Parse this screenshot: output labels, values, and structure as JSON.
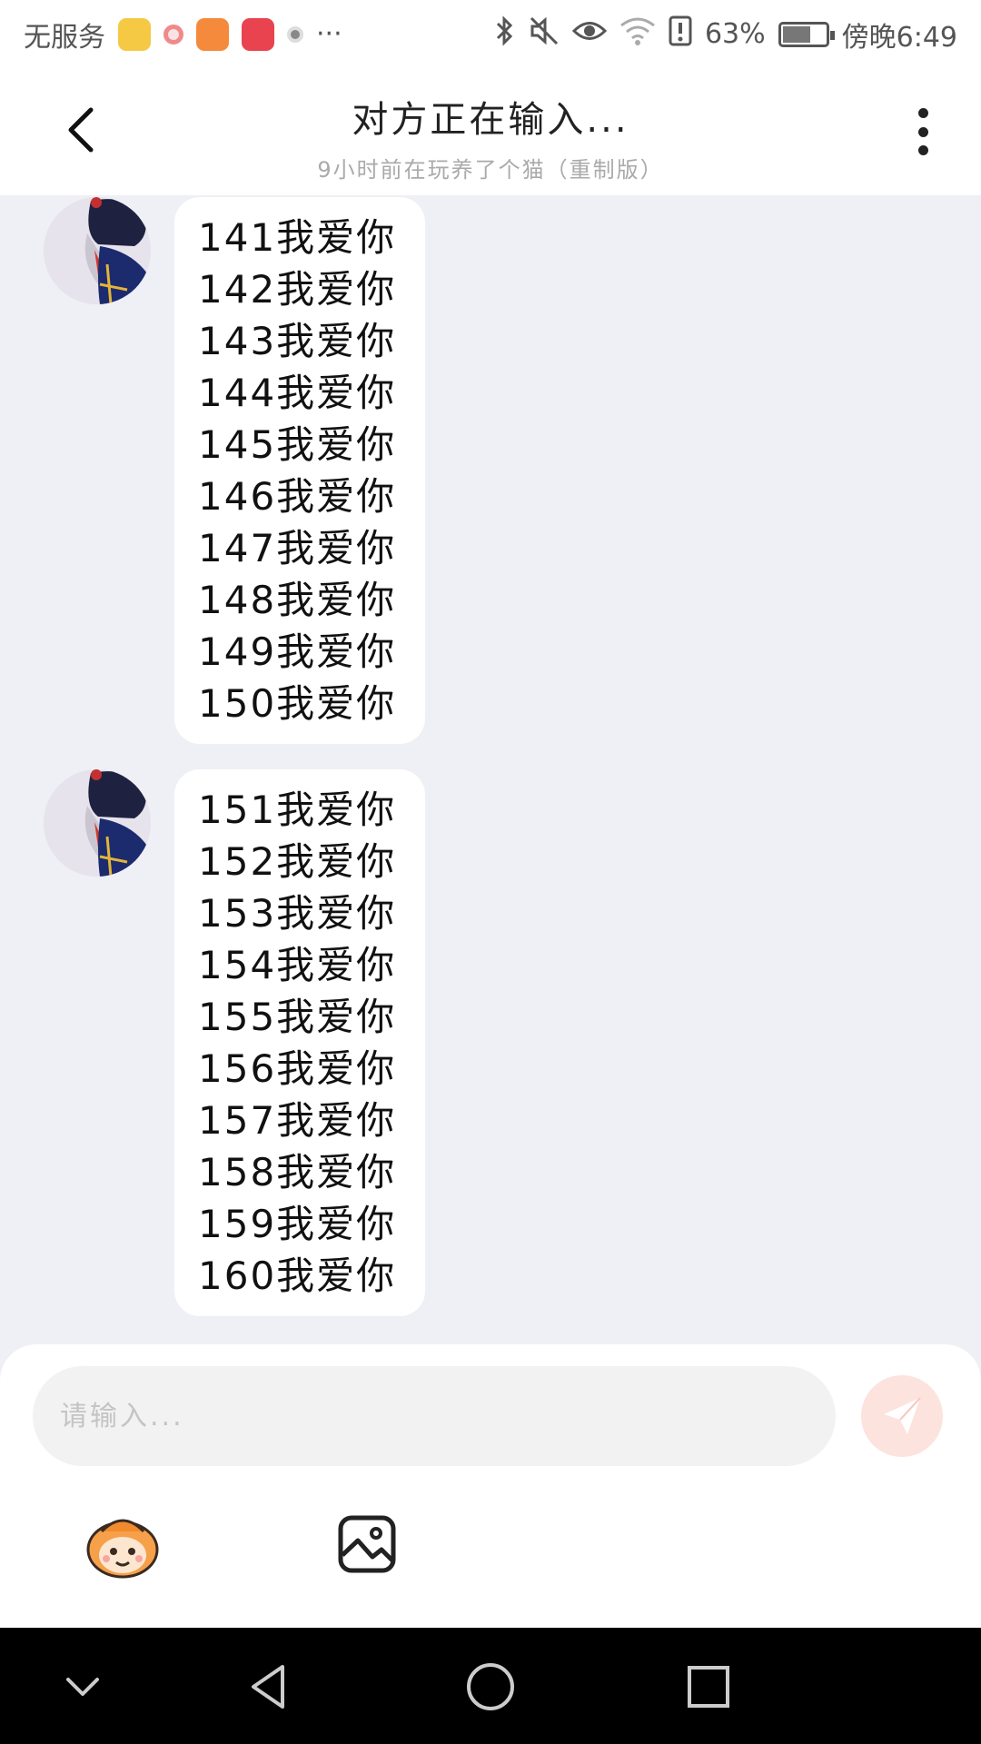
{
  "status_bar": {
    "carrier": "无服务",
    "battery": "63%",
    "time": "傍晚6:49",
    "more_indicator": "···",
    "icons": [
      "bluetooth-icon",
      "mute-icon",
      "eye-icon",
      "wifi-icon",
      "alert-icon",
      "battery-icon"
    ]
  },
  "header": {
    "title": "对方正在输入...",
    "subtitle": "9小时前在玩养了个猫（重制版）"
  },
  "messages": [
    {
      "sender": "other",
      "lines": [
        "141我爱你",
        "142我爱你",
        "143我爱你",
        "144我爱你",
        "145我爱你",
        "146我爱你",
        "147我爱你",
        "148我爱你",
        "149我爱你",
        "150我爱你"
      ]
    },
    {
      "sender": "other",
      "lines": [
        "151我爱你",
        "152我爱你",
        "153我爱你",
        "154我爱你",
        "155我爱你",
        "156我爱你",
        "157我爱你",
        "158我爱你",
        "159我爱你",
        "160我爱你"
      ]
    }
  ],
  "composer": {
    "placeholder": "请输入...",
    "send_icon": "send-icon",
    "accent": "#f47a6a"
  },
  "toolbar": {
    "emoji_icon": "emoji-icon",
    "image_icon": "image-icon"
  },
  "navbar": {
    "icons": [
      "collapse-icon",
      "back-triangle-icon",
      "home-circle-icon",
      "recents-square-icon"
    ]
  }
}
